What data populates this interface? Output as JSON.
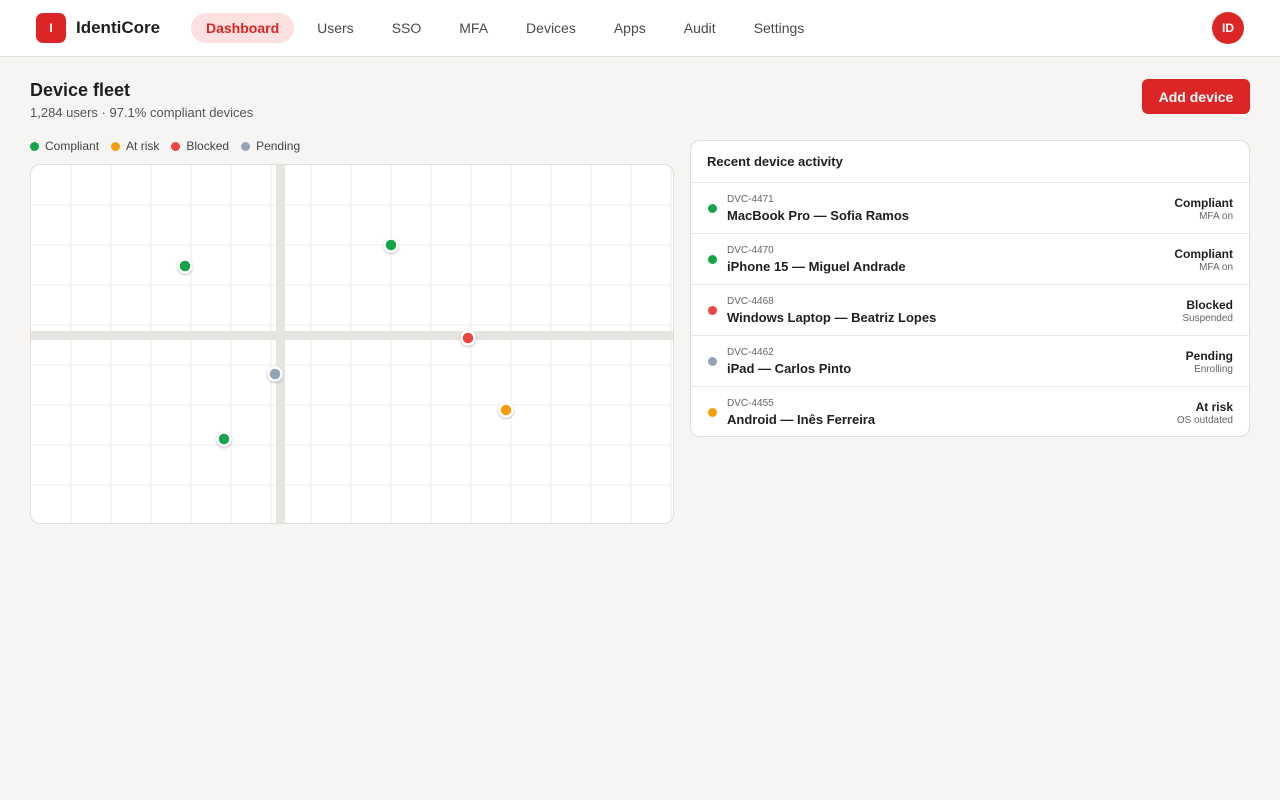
{
  "app": {
    "logo_letter": "I",
    "name": "IdentiCore",
    "avatar_initials": "ID"
  },
  "nav": [
    {
      "label": "Dashboard",
      "active": true
    },
    {
      "label": "Users",
      "active": false
    },
    {
      "label": "SSO",
      "active": false
    },
    {
      "label": "MFA",
      "active": false
    },
    {
      "label": "Devices",
      "active": false
    },
    {
      "label": "Apps",
      "active": false
    },
    {
      "label": "Audit",
      "active": false
    },
    {
      "label": "Settings",
      "active": false
    }
  ],
  "header": {
    "title": "Device fleet",
    "subtitle": "1,284 users · 97.1% compliant devices",
    "add_button": "Add device"
  },
  "legend": [
    {
      "label": "Compliant",
      "color": "#16a34a"
    },
    {
      "label": "At risk",
      "color": "#f59e0b"
    },
    {
      "label": "Blocked",
      "color": "#ef4444"
    },
    {
      "label": "Pending",
      "color": "#94a3b8"
    }
  ],
  "activity": {
    "title": "Recent device activity",
    "rows": [
      {
        "id": "DVC-4471",
        "name": "MacBook Pro — Sofia Ramos",
        "status": "Compliant",
        "detail": "MFA on",
        "color": "#16a34a"
      },
      {
        "id": "DVC-4470",
        "name": "iPhone 15 — Miguel Andrade",
        "status": "Compliant",
        "detail": "MFA on",
        "color": "#16a34a"
      },
      {
        "id": "DVC-4468",
        "name": "Windows Laptop — Beatriz Lopes",
        "status": "Blocked",
        "detail": "Suspended",
        "color": "#ef4444"
      },
      {
        "id": "DVC-4462",
        "name": "iPad — Carlos Pinto",
        "status": "Pending",
        "detail": "Enrolling",
        "color": "#94a3b8"
      },
      {
        "id": "DVC-4455",
        "name": "Android — Inês Ferreira",
        "status": "At risk",
        "detail": "OS outdated",
        "color": "#f59e0b"
      }
    ]
  }
}
